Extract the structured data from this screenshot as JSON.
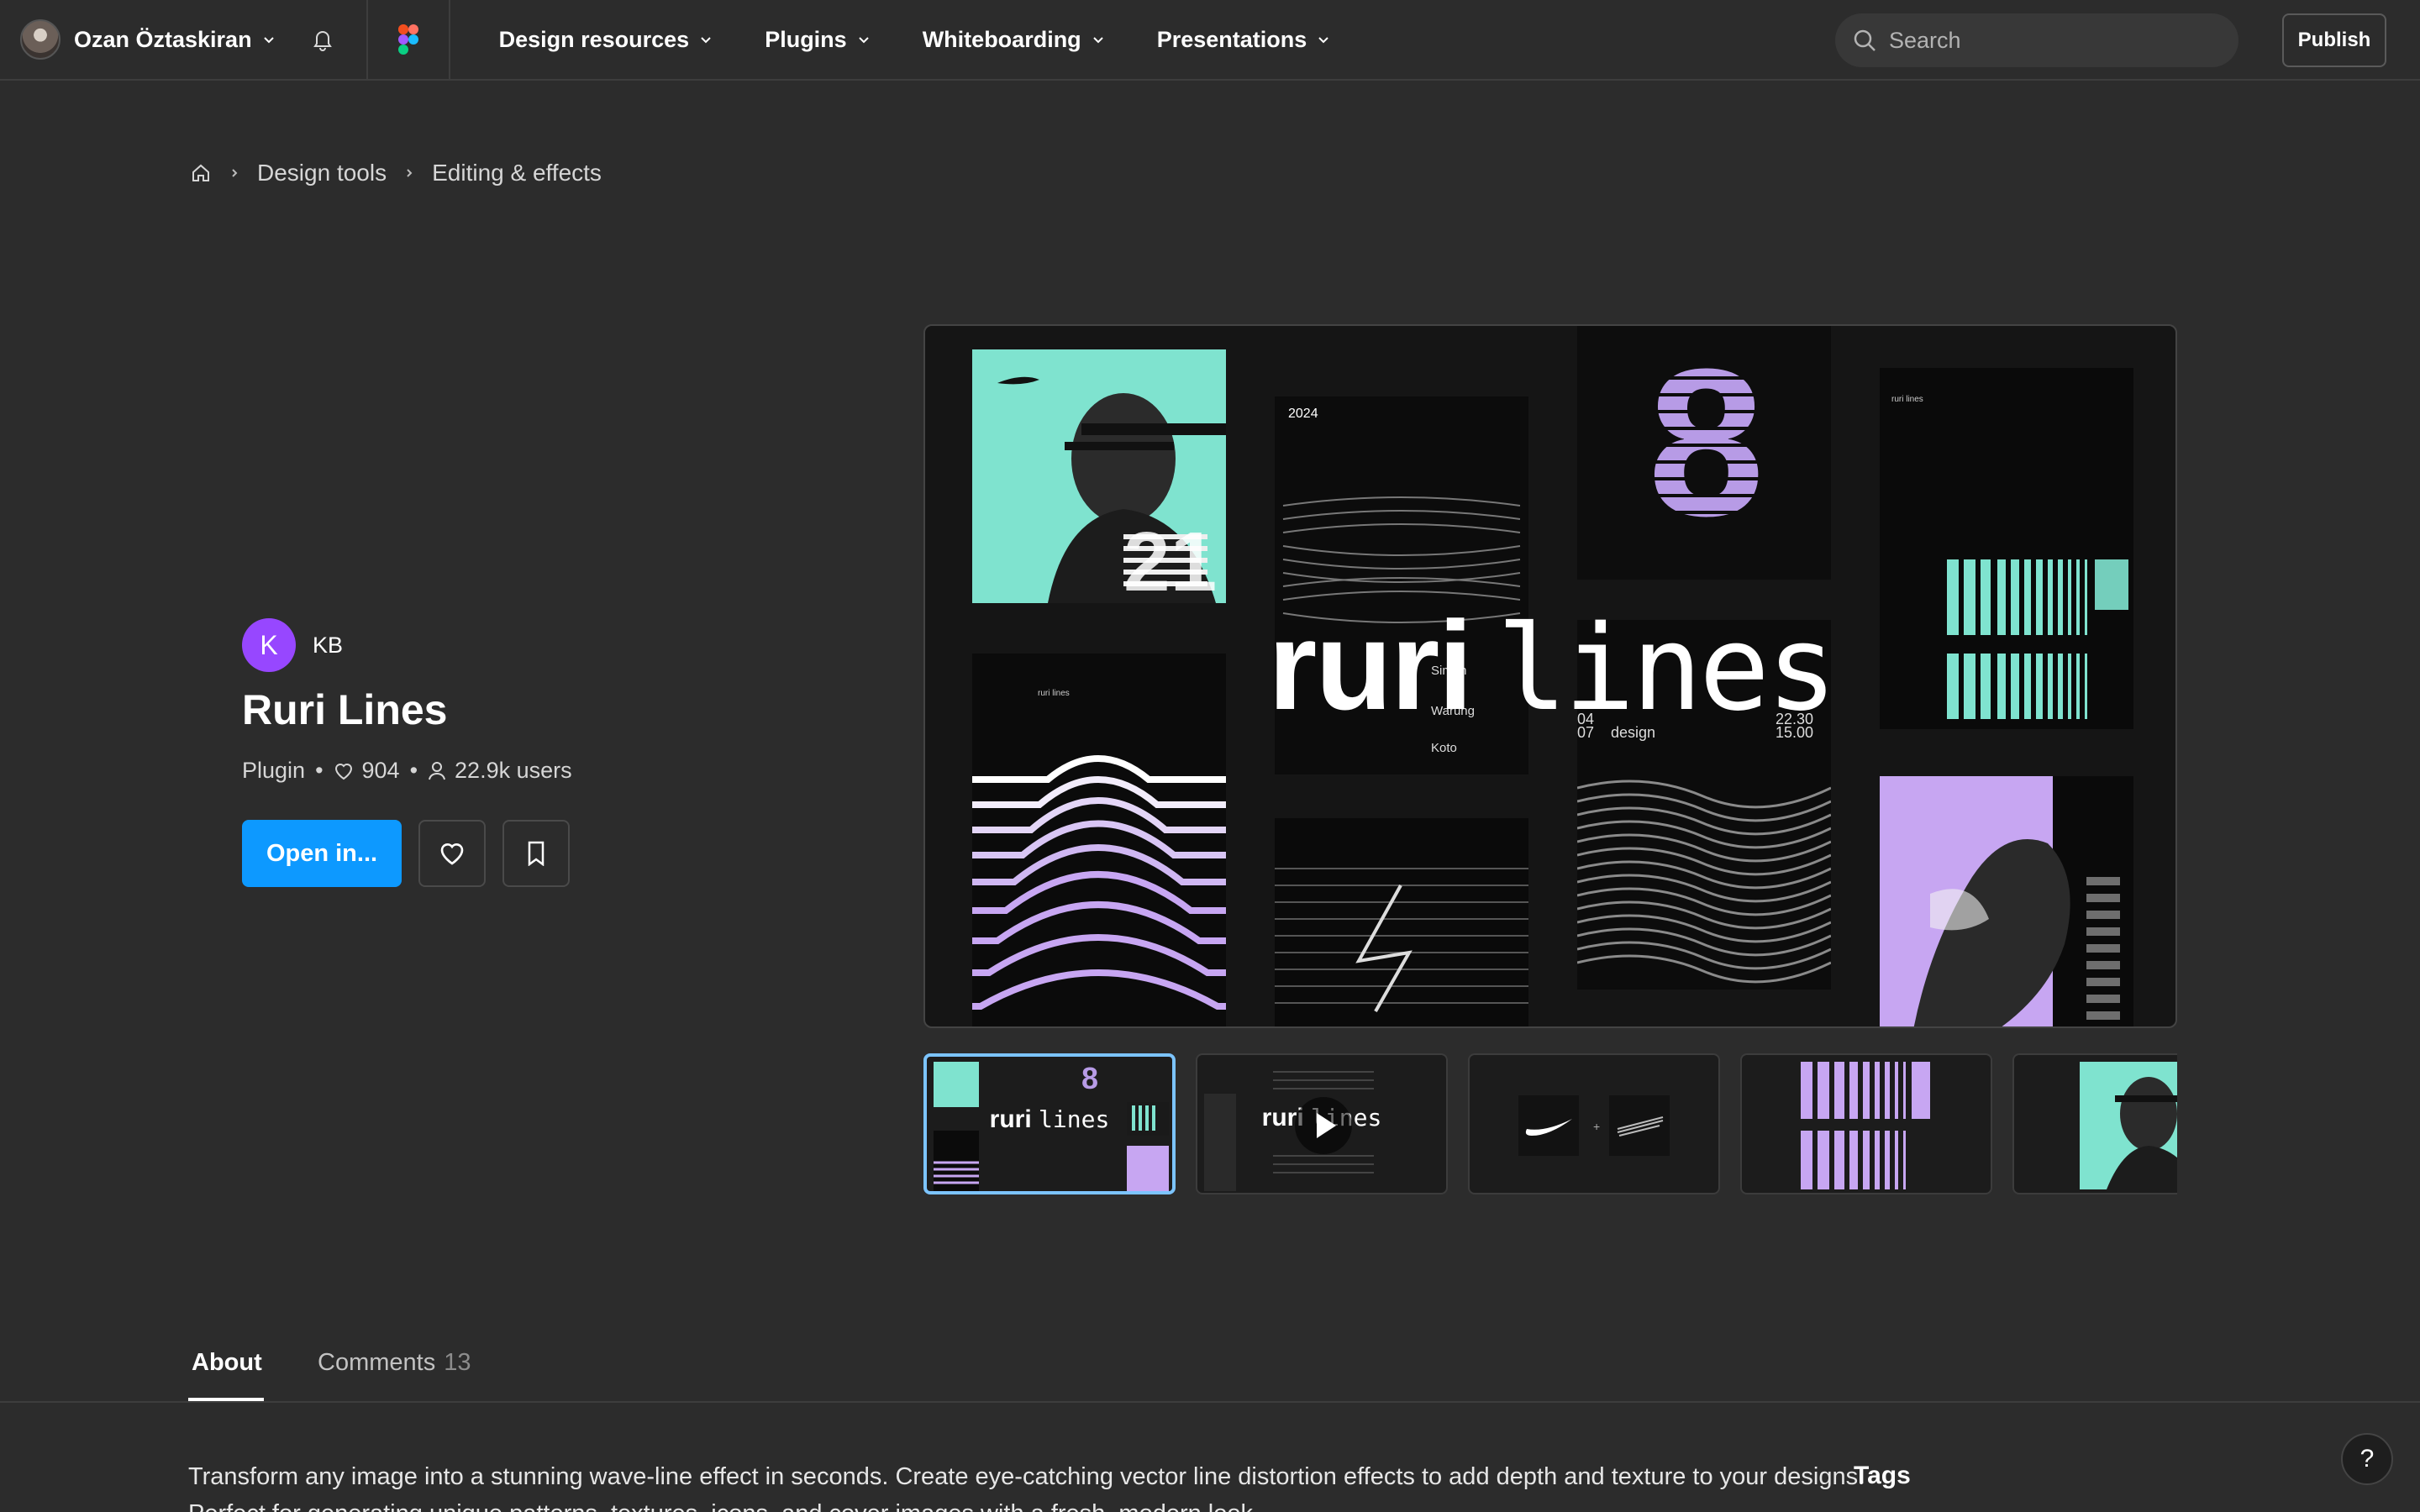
{
  "topbar": {
    "user_name": "Ozan Öztaskiran",
    "nav": [
      "Design resources",
      "Plugins",
      "Whiteboarding",
      "Presentations"
    ],
    "search_placeholder": "Search",
    "publish_label": "Publish"
  },
  "breadcrumb": {
    "items": [
      "Design tools",
      "Editing & effects"
    ]
  },
  "resource": {
    "creator_initial": "K",
    "creator_name": "KB",
    "title": "Ruri Lines",
    "type": "Plugin",
    "likes": "904",
    "users": "22.9k users",
    "open_label": "Open in..."
  },
  "hero": {
    "title_bold": "ruri",
    "title_mono": "lines",
    "poster_year": "2024",
    "poster_text_1": "Simon",
    "poster_text_2": "Warung",
    "poster_text_3": "Koto",
    "poster_num_1": "04",
    "poster_num_2": "07",
    "poster_design": "design",
    "poster_time_1": "22.30",
    "poster_time_2": "15.00",
    "poster_eight": "8",
    "poster_21": "21",
    "poster_small_label": "ruri lines"
  },
  "thumbnails": [
    {
      "bold": "ruri",
      "mono": "lines"
    },
    {
      "bold": "ruri",
      "mono": "lines"
    }
  ],
  "tabs": {
    "about": "About",
    "comments": "Comments",
    "comments_count": "13"
  },
  "about": {
    "text": "Transform any image into a stunning wave-line effect in seconds. Create eye-catching vector line distortion effects to add depth and texture to your designs. Perfect for generating unique patterns, textures, icons, and cover images with a fresh, modern look.",
    "tags_heading": "Tags"
  },
  "help_label": "?",
  "colors": {
    "background": "#2c2c2c",
    "accent": "#0d99ff",
    "creator_avatar": "#9747ff",
    "mint": "#7fe3cf",
    "lavender": "#c7a6f2"
  }
}
